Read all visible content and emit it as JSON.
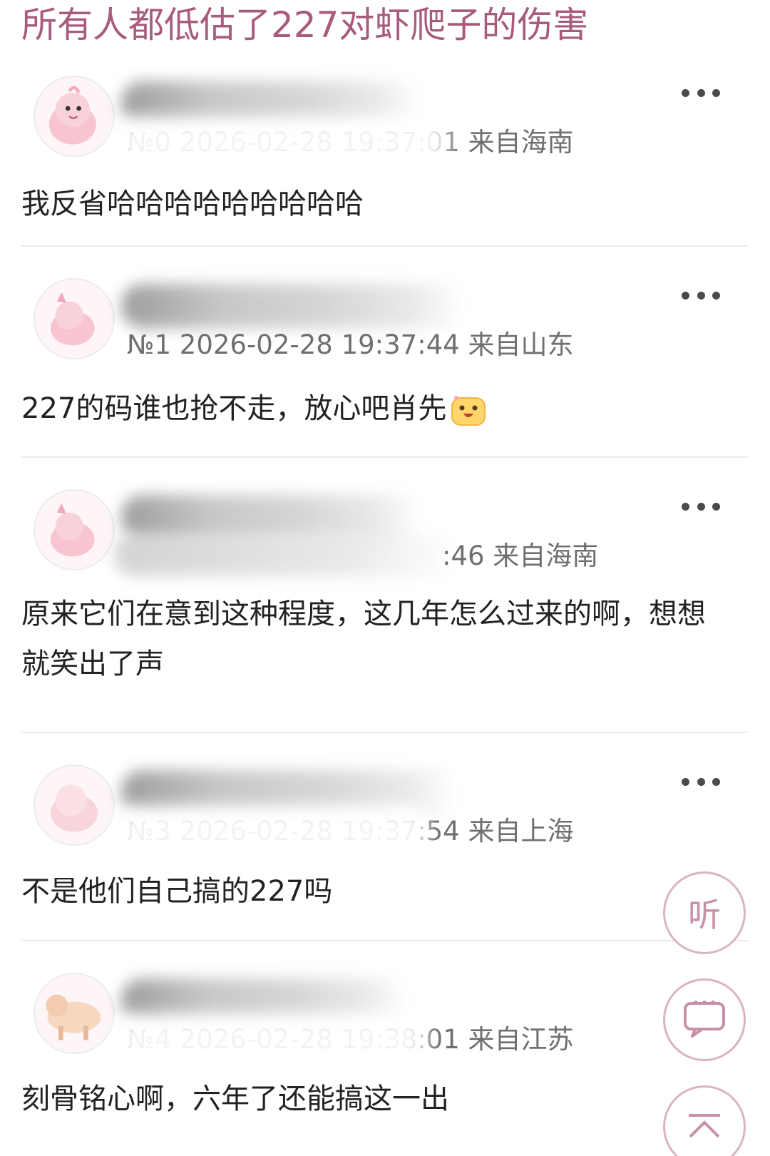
{
  "page": {
    "title": "所有人都低估了227对虾爬子的伤害"
  },
  "replies": [
    {
      "meta": "№0 2026-02-28 19:37:01 来自海南",
      "text": "我反省哈哈哈哈哈哈哈哈哈",
      "avatar_icon": "pink-cartoon-avatar-icon"
    },
    {
      "meta": "№1 2026-02-28 19:37:44 来自山东",
      "text": "227的码谁也抢不走，放心吧肖先",
      "emoji_icon": "happy-face-emoji-icon",
      "avatar_icon": "pink-cartoon-avatar-icon"
    },
    {
      "meta": ":46 来自海南",
      "text": "原来它们在意到这种程度，这几年怎么过来的啊，想想就笑出了声",
      "avatar_icon": "pink-cartoon-avatar-icon"
    },
    {
      "meta": "№3 2026-02-28 19:37:54 来自上海",
      "text": "不是他们自己搞的227吗",
      "avatar_icon": "pink-cartoon-avatar-icon"
    },
    {
      "meta": "№4 2026-02-28 19:38:01 来自江苏",
      "text": "刻骨铭心啊，六年了还能搞这一出",
      "avatar_icon": "orange-cartoon-avatar-icon"
    }
  ],
  "floating": {
    "listen_label": "听",
    "comment_icon": "comment-bubble-icon",
    "top_icon": "back-to-top-icon"
  },
  "colors": {
    "title": "#a85b7c",
    "meta": "#6f6f6f",
    "text": "#222222",
    "divider": "#ececec",
    "fab_border": "#d9b3c4"
  }
}
